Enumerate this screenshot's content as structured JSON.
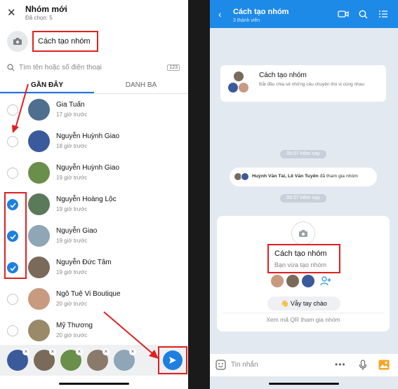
{
  "left": {
    "title": "Nhóm mới",
    "subtitle": "Đã chọn: 5",
    "group_name": "Cách tạo nhóm",
    "search_placeholder": "Tìm tên hoặc số điện thoại",
    "keyboard_badge": "123",
    "tabs": [
      {
        "label": "GẦN ĐÂY",
        "active": true
      },
      {
        "label": "DANH BẠ",
        "active": false
      }
    ],
    "contacts": [
      {
        "name": "Gia Tuấn",
        "time": "17 giờ trước",
        "checked": false,
        "color": "#4f6f8f"
      },
      {
        "name": "Nguyễn Huỳnh Giao",
        "time": "18 giờ trước",
        "checked": false,
        "color": "#3a5a9c"
      },
      {
        "name": "Nguyễn Huỳnh Giao",
        "time": "19 giờ trước",
        "checked": false,
        "color": "#6a8f4a"
      },
      {
        "name": "Nguyễn Hoàng Lộc",
        "time": "19 giờ trước",
        "checked": true,
        "color": "#5a7a5a"
      },
      {
        "name": "Nguyễn Giao",
        "time": "19 giờ trước",
        "checked": true,
        "color": "#8ea6b6"
      },
      {
        "name": "Nguyễn Đức Tâm",
        "time": "19 giờ trước",
        "checked": true,
        "color": "#7a6a5a"
      },
      {
        "name": "Ngô Tuệ Vi Boutique",
        "time": "20 giờ trước",
        "checked": false,
        "color": "#c89a80"
      },
      {
        "name": "Mỹ Thương",
        "time": "20 giờ trước",
        "checked": false,
        "color": "#9a8a6a"
      }
    ],
    "selected_colors": [
      "#3a5a9c",
      "#7a6a5a",
      "#6a8f4a",
      "#8a7a6a",
      "#8ea6b6"
    ]
  },
  "right": {
    "title": "Cách tạo nhóm",
    "subtitle": "3 thành viên",
    "info_title": "Cách tạo nhóm",
    "info_desc": "Bắt đầu chia sẻ những câu chuyện thú vị cùng nhau",
    "time1": "09:57 Hôm nay",
    "joined_names": "Huỳnh Văn Tài, Lê Văn Tuyên",
    "joined_suffix": " đã tham gia nhóm",
    "time2": "09:57 Hôm nay",
    "group_name": "Cách tạo nhóm",
    "group_sub": "Bạn vừa tạo nhóm",
    "wave_label": "Vẫy tay chào",
    "qr_label": "Xem mã QR tham gia nhóm",
    "input_placeholder": "Tin nhắn",
    "accent": "#1e8ae8"
  }
}
